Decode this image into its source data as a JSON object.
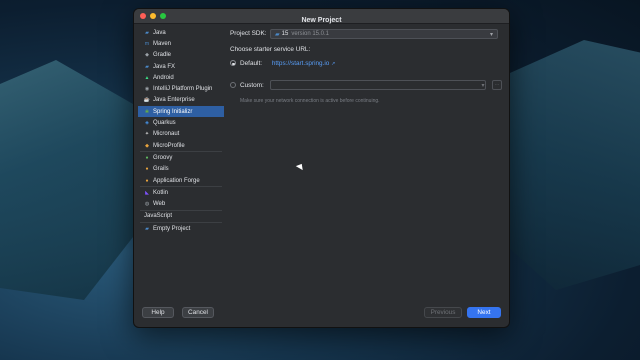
{
  "window": {
    "title": "New Project"
  },
  "sidebar": {
    "items": [
      {
        "label": "Java",
        "icon": "folder-icon",
        "color": "#4a88c7"
      },
      {
        "label": "Maven",
        "icon": "maven-icon",
        "color": "#4a88c7"
      },
      {
        "label": "Gradle",
        "icon": "gradle-icon",
        "color": "#9aa0a6"
      },
      {
        "label": "Java FX",
        "icon": "folder-icon",
        "color": "#4a88c7"
      },
      {
        "label": "Android",
        "icon": "android-icon",
        "color": "#3ddc84"
      },
      {
        "label": "IntelliJ Platform Plugin",
        "icon": "plugin-icon",
        "color": "#9aa0a6"
      },
      {
        "label": "Java Enterprise",
        "icon": "java-enterprise-icon",
        "color": "#e8a33d"
      },
      {
        "label": "Spring Initializr",
        "icon": "spring-icon",
        "color": "#6db33f"
      },
      {
        "label": "Quarkus",
        "icon": "quarkus-icon",
        "color": "#4695eb"
      },
      {
        "label": "Micronaut",
        "icon": "micronaut-icon",
        "color": "#c9c9c9"
      },
      {
        "label": "MicroProfile",
        "icon": "microprofile-icon",
        "color": "#e8a33d"
      },
      {
        "label": "Groovy",
        "icon": "groovy-icon",
        "color": "#5fb85f"
      },
      {
        "label": "Grails",
        "icon": "grails-icon",
        "color": "#e8a33d"
      },
      {
        "label": "Application Forge",
        "icon": "forge-icon",
        "color": "#e8a33d"
      },
      {
        "label": "Kotlin",
        "icon": "kotlin-icon",
        "color": "#7f52ff"
      },
      {
        "label": "Web",
        "icon": "globe-icon",
        "color": "#9aa0a6"
      },
      {
        "label": "JavaScript",
        "icon": "",
        "color": ""
      },
      {
        "label": "Empty Project",
        "icon": "folder-icon",
        "color": "#4a88c7"
      }
    ],
    "selected_index": 7
  },
  "content": {
    "sdk_label": "Project SDK:",
    "sdk_value": "15",
    "sdk_version": "version 15.0.1",
    "starter_label": "Choose starter service URL:",
    "default_label": "Default:",
    "default_url": "https://start.spring.io",
    "external_link_glyph": "↗",
    "custom_label": "Custom:",
    "custom_value": "",
    "hint": "Make sure your network connection is active before continuing."
  },
  "buttons": {
    "help": "Help",
    "cancel": "Cancel",
    "previous": "Previous",
    "next": "Next"
  }
}
